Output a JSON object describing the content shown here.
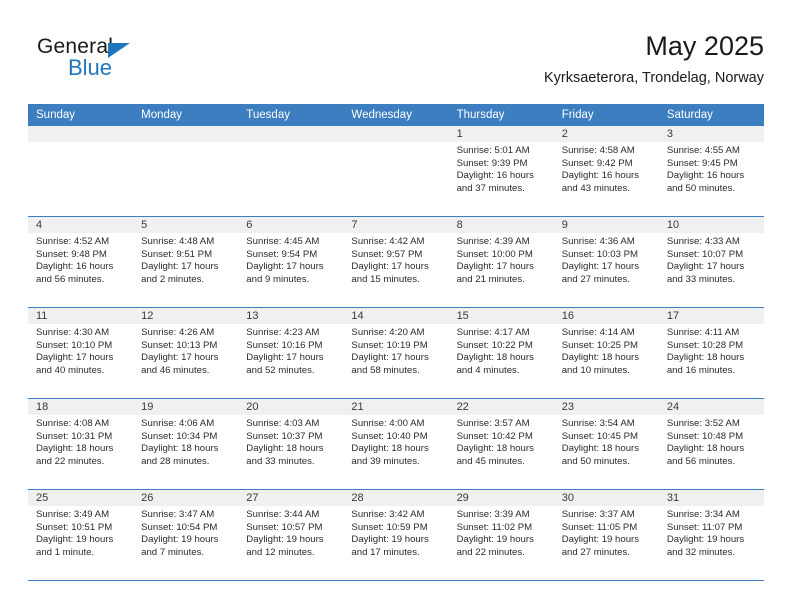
{
  "brand": {
    "name_part1": "General",
    "name_part2": "Blue",
    "triangle_color": "#1f76bc",
    "text_color": "#1a1a1a"
  },
  "header": {
    "title": "May 2025",
    "subtitle": "Kyrksaeterora, Trondelag, Norway"
  },
  "theme": {
    "header_bg": "#3c7ebf",
    "header_text": "#ffffff",
    "day_band_bg": "#f0f0f0",
    "row_divider": "#3c7ebf",
    "page_bg": "#ffffff"
  },
  "weekdays": [
    "Sunday",
    "Monday",
    "Tuesday",
    "Wednesday",
    "Thursday",
    "Friday",
    "Saturday"
  ],
  "labels": {
    "sunrise": "Sunrise:",
    "sunset": "Sunset:",
    "daylight": "Daylight:"
  },
  "weeks": [
    [
      {
        "day": ""
      },
      {
        "day": ""
      },
      {
        "day": ""
      },
      {
        "day": ""
      },
      {
        "day": "1",
        "sunrise": "Sunrise: 5:01 AM",
        "sunset": "Sunset: 9:39 PM",
        "daylight_line1": "Daylight: 16 hours",
        "daylight_line2": "and 37 minutes."
      },
      {
        "day": "2",
        "sunrise": "Sunrise: 4:58 AM",
        "sunset": "Sunset: 9:42 PM",
        "daylight_line1": "Daylight: 16 hours",
        "daylight_line2": "and 43 minutes."
      },
      {
        "day": "3",
        "sunrise": "Sunrise: 4:55 AM",
        "sunset": "Sunset: 9:45 PM",
        "daylight_line1": "Daylight: 16 hours",
        "daylight_line2": "and 50 minutes."
      }
    ],
    [
      {
        "day": "4",
        "sunrise": "Sunrise: 4:52 AM",
        "sunset": "Sunset: 9:48 PM",
        "daylight_line1": "Daylight: 16 hours",
        "daylight_line2": "and 56 minutes."
      },
      {
        "day": "5",
        "sunrise": "Sunrise: 4:48 AM",
        "sunset": "Sunset: 9:51 PM",
        "daylight_line1": "Daylight: 17 hours",
        "daylight_line2": "and 2 minutes."
      },
      {
        "day": "6",
        "sunrise": "Sunrise: 4:45 AM",
        "sunset": "Sunset: 9:54 PM",
        "daylight_line1": "Daylight: 17 hours",
        "daylight_line2": "and 9 minutes."
      },
      {
        "day": "7",
        "sunrise": "Sunrise: 4:42 AM",
        "sunset": "Sunset: 9:57 PM",
        "daylight_line1": "Daylight: 17 hours",
        "daylight_line2": "and 15 minutes."
      },
      {
        "day": "8",
        "sunrise": "Sunrise: 4:39 AM",
        "sunset": "Sunset: 10:00 PM",
        "daylight_line1": "Daylight: 17 hours",
        "daylight_line2": "and 21 minutes."
      },
      {
        "day": "9",
        "sunrise": "Sunrise: 4:36 AM",
        "sunset": "Sunset: 10:03 PM",
        "daylight_line1": "Daylight: 17 hours",
        "daylight_line2": "and 27 minutes."
      },
      {
        "day": "10",
        "sunrise": "Sunrise: 4:33 AM",
        "sunset": "Sunset: 10:07 PM",
        "daylight_line1": "Daylight: 17 hours",
        "daylight_line2": "and 33 minutes."
      }
    ],
    [
      {
        "day": "11",
        "sunrise": "Sunrise: 4:30 AM",
        "sunset": "Sunset: 10:10 PM",
        "daylight_line1": "Daylight: 17 hours",
        "daylight_line2": "and 40 minutes."
      },
      {
        "day": "12",
        "sunrise": "Sunrise: 4:26 AM",
        "sunset": "Sunset: 10:13 PM",
        "daylight_line1": "Daylight: 17 hours",
        "daylight_line2": "and 46 minutes."
      },
      {
        "day": "13",
        "sunrise": "Sunrise: 4:23 AM",
        "sunset": "Sunset: 10:16 PM",
        "daylight_line1": "Daylight: 17 hours",
        "daylight_line2": "and 52 minutes."
      },
      {
        "day": "14",
        "sunrise": "Sunrise: 4:20 AM",
        "sunset": "Sunset: 10:19 PM",
        "daylight_line1": "Daylight: 17 hours",
        "daylight_line2": "and 58 minutes."
      },
      {
        "day": "15",
        "sunrise": "Sunrise: 4:17 AM",
        "sunset": "Sunset: 10:22 PM",
        "daylight_line1": "Daylight: 18 hours",
        "daylight_line2": "and 4 minutes."
      },
      {
        "day": "16",
        "sunrise": "Sunrise: 4:14 AM",
        "sunset": "Sunset: 10:25 PM",
        "daylight_line1": "Daylight: 18 hours",
        "daylight_line2": "and 10 minutes."
      },
      {
        "day": "17",
        "sunrise": "Sunrise: 4:11 AM",
        "sunset": "Sunset: 10:28 PM",
        "daylight_line1": "Daylight: 18 hours",
        "daylight_line2": "and 16 minutes."
      }
    ],
    [
      {
        "day": "18",
        "sunrise": "Sunrise: 4:08 AM",
        "sunset": "Sunset: 10:31 PM",
        "daylight_line1": "Daylight: 18 hours",
        "daylight_line2": "and 22 minutes."
      },
      {
        "day": "19",
        "sunrise": "Sunrise: 4:06 AM",
        "sunset": "Sunset: 10:34 PM",
        "daylight_line1": "Daylight: 18 hours",
        "daylight_line2": "and 28 minutes."
      },
      {
        "day": "20",
        "sunrise": "Sunrise: 4:03 AM",
        "sunset": "Sunset: 10:37 PM",
        "daylight_line1": "Daylight: 18 hours",
        "daylight_line2": "and 33 minutes."
      },
      {
        "day": "21",
        "sunrise": "Sunrise: 4:00 AM",
        "sunset": "Sunset: 10:40 PM",
        "daylight_line1": "Daylight: 18 hours",
        "daylight_line2": "and 39 minutes."
      },
      {
        "day": "22",
        "sunrise": "Sunrise: 3:57 AM",
        "sunset": "Sunset: 10:42 PM",
        "daylight_line1": "Daylight: 18 hours",
        "daylight_line2": "and 45 minutes."
      },
      {
        "day": "23",
        "sunrise": "Sunrise: 3:54 AM",
        "sunset": "Sunset: 10:45 PM",
        "daylight_line1": "Daylight: 18 hours",
        "daylight_line2": "and 50 minutes."
      },
      {
        "day": "24",
        "sunrise": "Sunrise: 3:52 AM",
        "sunset": "Sunset: 10:48 PM",
        "daylight_line1": "Daylight: 18 hours",
        "daylight_line2": "and 56 minutes."
      }
    ],
    [
      {
        "day": "25",
        "sunrise": "Sunrise: 3:49 AM",
        "sunset": "Sunset: 10:51 PM",
        "daylight_line1": "Daylight: 19 hours",
        "daylight_line2": "and 1 minute."
      },
      {
        "day": "26",
        "sunrise": "Sunrise: 3:47 AM",
        "sunset": "Sunset: 10:54 PM",
        "daylight_line1": "Daylight: 19 hours",
        "daylight_line2": "and 7 minutes."
      },
      {
        "day": "27",
        "sunrise": "Sunrise: 3:44 AM",
        "sunset": "Sunset: 10:57 PM",
        "daylight_line1": "Daylight: 19 hours",
        "daylight_line2": "and 12 minutes."
      },
      {
        "day": "28",
        "sunrise": "Sunrise: 3:42 AM",
        "sunset": "Sunset: 10:59 PM",
        "daylight_line1": "Daylight: 19 hours",
        "daylight_line2": "and 17 minutes."
      },
      {
        "day": "29",
        "sunrise": "Sunrise: 3:39 AM",
        "sunset": "Sunset: 11:02 PM",
        "daylight_line1": "Daylight: 19 hours",
        "daylight_line2": "and 22 minutes."
      },
      {
        "day": "30",
        "sunrise": "Sunrise: 3:37 AM",
        "sunset": "Sunset: 11:05 PM",
        "daylight_line1": "Daylight: 19 hours",
        "daylight_line2": "and 27 minutes."
      },
      {
        "day": "31",
        "sunrise": "Sunrise: 3:34 AM",
        "sunset": "Sunset: 11:07 PM",
        "daylight_line1": "Daylight: 19 hours",
        "daylight_line2": "and 32 minutes."
      }
    ]
  ]
}
